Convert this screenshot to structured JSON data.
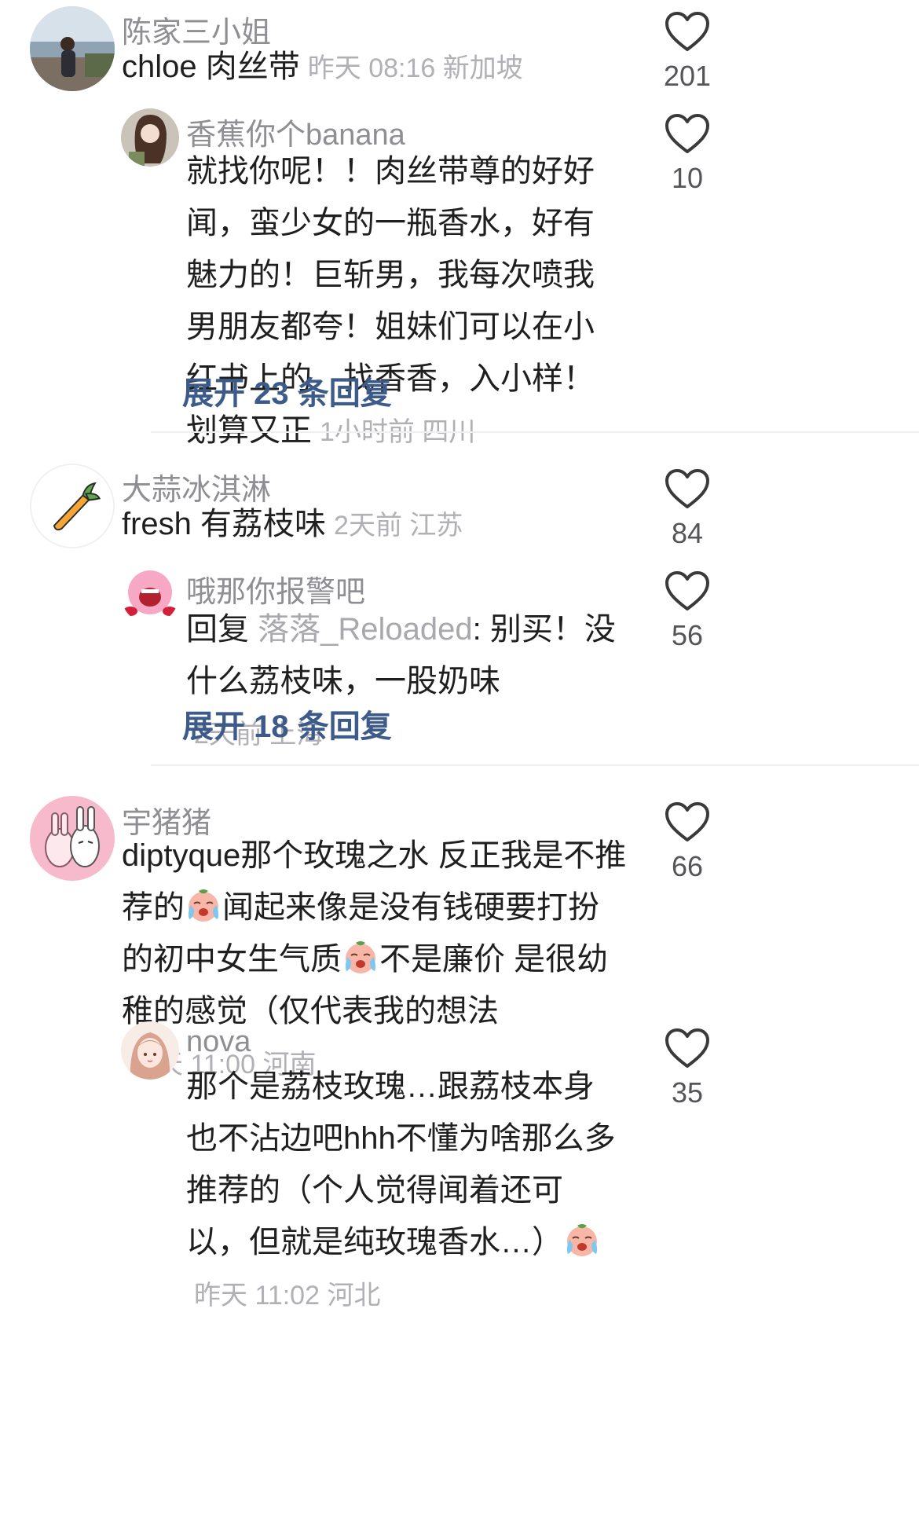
{
  "comments": [
    {
      "user": "陈家三小姐",
      "text": "chloe 肉丝带",
      "meta": "昨天 08:16 新加坡",
      "likes": "201",
      "replies": [
        {
          "user": "香蕉你个banana",
          "text": "就找你呢！！肉丝带尊的好好闻，蛮少女的一瓶香水，好有魅力的！巨斩男，我每次喷我男朋友都夸！姐妹们可以在小红书上的　找香香，入小样！划算又正",
          "meta": "1小时前 四川",
          "likes": "10"
        }
      ],
      "expand": "展开 23 条回复"
    },
    {
      "user": "大蒜冰淇淋",
      "text": "fresh 有荔枝味",
      "meta": "2天前 江苏",
      "likes": "84",
      "replies": [
        {
          "user": "哦那你报警吧",
          "reply_prefix": "回复",
          "reply_to": "落落_Reloaded",
          "text": ": 别买！没什么荔枝味，一股奶味",
          "meta": "2天前 上海",
          "likes": "56"
        }
      ],
      "expand": "展开 18 条回复"
    },
    {
      "user": "宇猪猪",
      "text_parts": [
        "diptyque那个玫瑰之水 反正我是不推荐的",
        "闻起来像是没有钱硬要打扮的初中女生气质",
        "不是廉价 是很幼稚的感觉（仅代表我的想法"
      ],
      "meta": "昨天 11:00 河南",
      "likes": "66",
      "replies": [
        {
          "user": "nova",
          "text": "那个是荔枝玫瑰…跟荔枝本身也不沾边吧hhh不懂为啥那么多推荐的（个人觉得闻着还可以，但就是纯玫瑰香水…）",
          "meta": "昨天 11:02 河北",
          "likes": "35"
        }
      ]
    }
  ],
  "colors": {
    "username": "#8e8e93",
    "meta": "#b0b0b5",
    "expand": "#3c5a8a",
    "divider": "#efefef"
  },
  "icons": {
    "like": "heart-outline-icon",
    "emoji": "crying-face-emoji-icon"
  }
}
